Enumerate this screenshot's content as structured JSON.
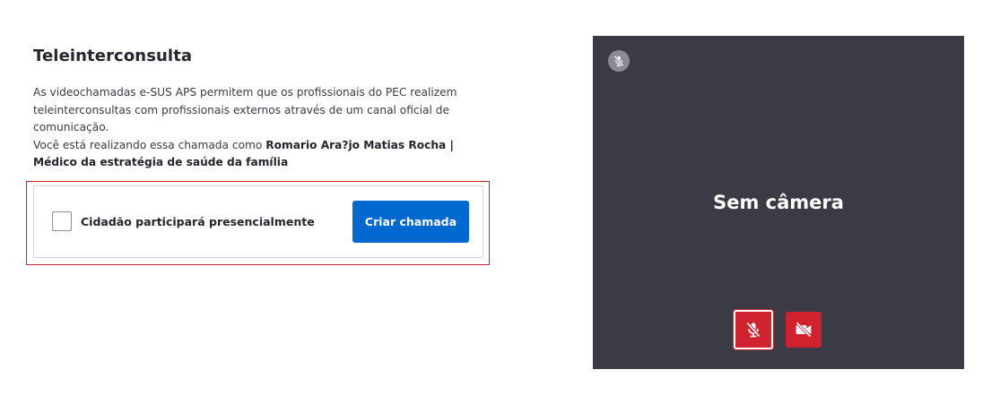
{
  "header": {
    "title": "Teleinterconsulta"
  },
  "description": {
    "line1": "As videochamadas e-SUS APS permitem que os profissionais do PEC realizem teleinterconsultas com profissionais externos através de um canal oficial de comunicação.",
    "line2_prefix": "Você está realizando essa chamada como ",
    "user_role": "Romario Ara?jo Matias Rocha | Médico da estratégia de saúde da família"
  },
  "form": {
    "checkbox_label": "Cidadão participará presencialmente",
    "checkbox_checked": false,
    "create_button_label": "Criar chamada"
  },
  "video": {
    "no_camera_text": "Sem câmera",
    "mic_status_icon": "mic-off-icon",
    "mic_button_icon": "mic-off-icon",
    "camera_button_icon": "camera-off-icon"
  },
  "colors": {
    "primary": "#0069d0",
    "danger": "#d0212f",
    "video_background": "#3b3b46"
  }
}
